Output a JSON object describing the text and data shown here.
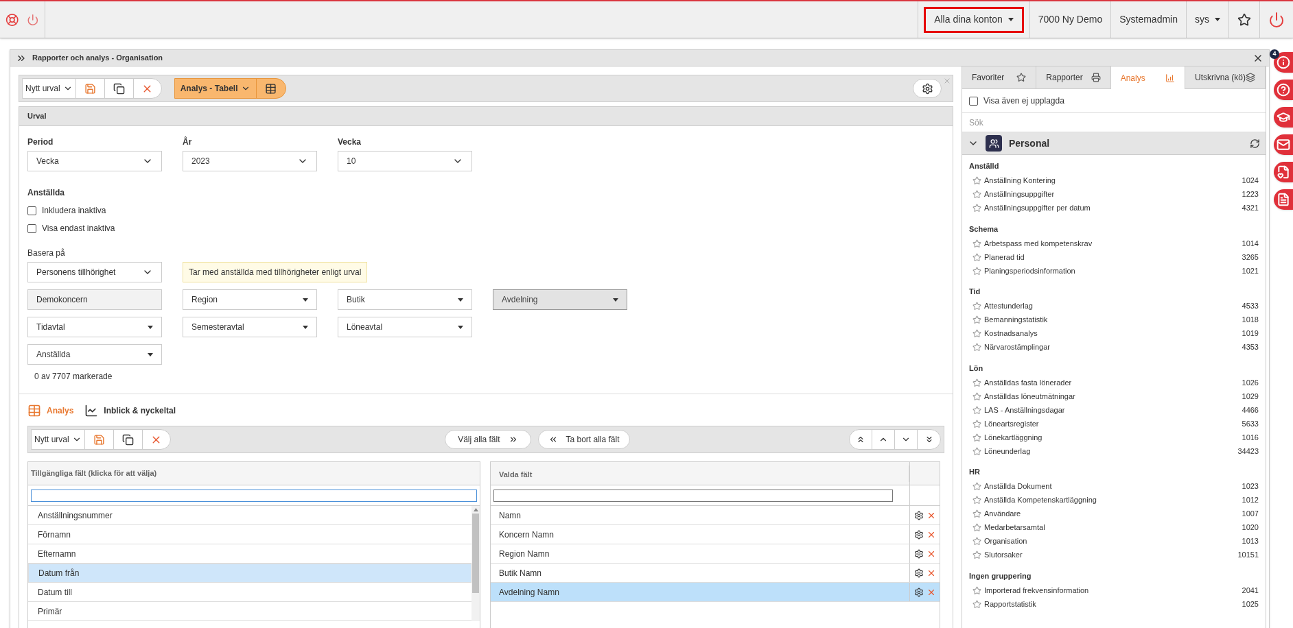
{
  "top_bar": {
    "account_menu": {
      "label": "Alla dina konton",
      "highlighted": true
    },
    "company": "7000 Ny Demo",
    "role": "Systemadmin",
    "user_menu": "sys"
  },
  "window": {
    "title": "Rapporter och analys - Organisation"
  },
  "toolbar": {
    "selection": "Nytt urval",
    "view_button": "Analys - Tabell"
  },
  "urval": {
    "title": "Urval",
    "fields": [
      {
        "label": "Period",
        "value": "Vecka"
      },
      {
        "label": "År",
        "value": "2023"
      },
      {
        "label": "Vecka",
        "value": "10"
      }
    ],
    "employees": {
      "label": "Anställda",
      "checkboxes": [
        {
          "label": "Inkludera inaktiva",
          "checked": false
        },
        {
          "label": "Visa endast inaktiva",
          "checked": false
        }
      ]
    },
    "base": {
      "label": "Basera på",
      "value": "Personens tillhörighet",
      "note": "Tar med anställda med tillhörigheter enligt urval"
    },
    "filter_rows": [
      [
        {
          "value": "Demokoncern",
          "kind": "readonly",
          "disabled": false
        },
        {
          "value": "Region",
          "kind": "dropdown",
          "disabled": false
        },
        {
          "value": "Butik",
          "kind": "dropdown",
          "disabled": false
        },
        {
          "value": "Avdelning",
          "kind": "dropdown",
          "disabled": true
        }
      ],
      [
        {
          "value": "Tidavtal",
          "kind": "dropdown",
          "disabled": false
        },
        {
          "value": "Semesteravtal",
          "kind": "dropdown",
          "disabled": false
        },
        {
          "value": "Löneavtal",
          "kind": "dropdown",
          "disabled": false
        }
      ],
      [
        {
          "value": "Anställda",
          "kind": "dropdown",
          "disabled": false
        }
      ]
    ],
    "count": "0 av 7707 markerade"
  },
  "sub_tabs": [
    {
      "label": "Analys",
      "selected": true,
      "kind": "table"
    },
    {
      "label": "Inblick & nyckeltal",
      "selected": false,
      "kind": "chart"
    }
  ],
  "field_toolbar": {
    "selection": "Nytt urval",
    "select_all": "Välj alla fält",
    "remove_all": "Ta bort alla fält"
  },
  "available": {
    "header": "Tillgängliga fält (klicka för att välja)",
    "items": [
      {
        "label": "Anställningsnummer",
        "selected": false
      },
      {
        "label": "Förnamn",
        "selected": false
      },
      {
        "label": "Efternamn",
        "selected": false
      },
      {
        "label": "Datum från",
        "selected": true
      },
      {
        "label": "Datum till",
        "selected": false
      },
      {
        "label": "Primär",
        "selected": false
      }
    ]
  },
  "chosen": {
    "header": "Valda fält",
    "items": [
      {
        "label": "Namn",
        "selected": false
      },
      {
        "label": "Koncern Namn",
        "selected": false
      },
      {
        "label": "Region Namn",
        "selected": false
      },
      {
        "label": "Butik Namn",
        "selected": false
      },
      {
        "label": "Avdelning Namn",
        "selected": true
      }
    ]
  },
  "right_panel": {
    "tabs": [
      {
        "label": "Favoriter",
        "selected": false,
        "kind": "star"
      },
      {
        "label": "Rapporter",
        "selected": false,
        "kind": "print"
      },
      {
        "label": "Analys",
        "selected": true,
        "kind": "chart"
      },
      {
        "label": "Utskrivna (kö)",
        "selected": false,
        "kind": "queue"
      }
    ],
    "show_unset": {
      "label": "Visa även ej upplagda",
      "checked": false
    },
    "search": {
      "placeholder": "Sök"
    },
    "category": {
      "title": "Personal",
      "expanded": true
    },
    "groups": [
      {
        "title": "Anställd",
        "reports": [
          {
            "name": "Anställning Kontering",
            "number": "1024"
          },
          {
            "name": "Anställningsuppgifter",
            "number": "1223"
          },
          {
            "name": "Anställningsuppgifter per datum",
            "number": "4321"
          }
        ]
      },
      {
        "title": "Schema",
        "reports": [
          {
            "name": "Arbetspass med kompetenskrav",
            "number": "1014"
          },
          {
            "name": "Planerad tid",
            "number": "3265"
          },
          {
            "name": "Planingsperiodsinformation",
            "number": "1021"
          }
        ]
      },
      {
        "title": "Tid",
        "reports": [
          {
            "name": "Attestunderlag",
            "number": "4533"
          },
          {
            "name": "Bemanningstatistik",
            "number": "1018"
          },
          {
            "name": "Kostnadsanalys",
            "number": "1019"
          },
          {
            "name": "Närvarostämplingar",
            "number": "4353"
          }
        ]
      },
      {
        "title": "Lön",
        "reports": [
          {
            "name": "Anställdas fasta lönerader",
            "number": "1026"
          },
          {
            "name": "Anställdas löneutmätningar",
            "number": "1029"
          },
          {
            "name": "LAS - Anställningsdagar",
            "number": "4466"
          },
          {
            "name": "Löneartsregister",
            "number": "5633"
          },
          {
            "name": "Lönekartläggning",
            "number": "1016"
          },
          {
            "name": "Löneunderlag",
            "number": "34423"
          }
        ]
      },
      {
        "title": "HR",
        "reports": [
          {
            "name": "Anställda Dokument",
            "number": "1023"
          },
          {
            "name": "Anställda Kompetenskartläggning",
            "number": "1012"
          },
          {
            "name": "Användare",
            "number": "1007"
          },
          {
            "name": "Medarbetarsamtal",
            "number": "1020"
          },
          {
            "name": "Organisation",
            "number": "1013"
          },
          {
            "name": "Slutorsaker",
            "number": "10151"
          }
        ]
      },
      {
        "title": "Ingen gruppering",
        "reports": [
          {
            "name": "Importerad frekvensinformation",
            "number": "2041"
          },
          {
            "name": "Rapportstatistik",
            "number": "1025"
          }
        ]
      }
    ]
  },
  "side_buttons": [
    {
      "kind": "info",
      "badge": "4"
    },
    {
      "kind": "help"
    },
    {
      "kind": "education"
    },
    {
      "kind": "mail"
    },
    {
      "kind": "pdf"
    },
    {
      "kind": "document"
    }
  ]
}
